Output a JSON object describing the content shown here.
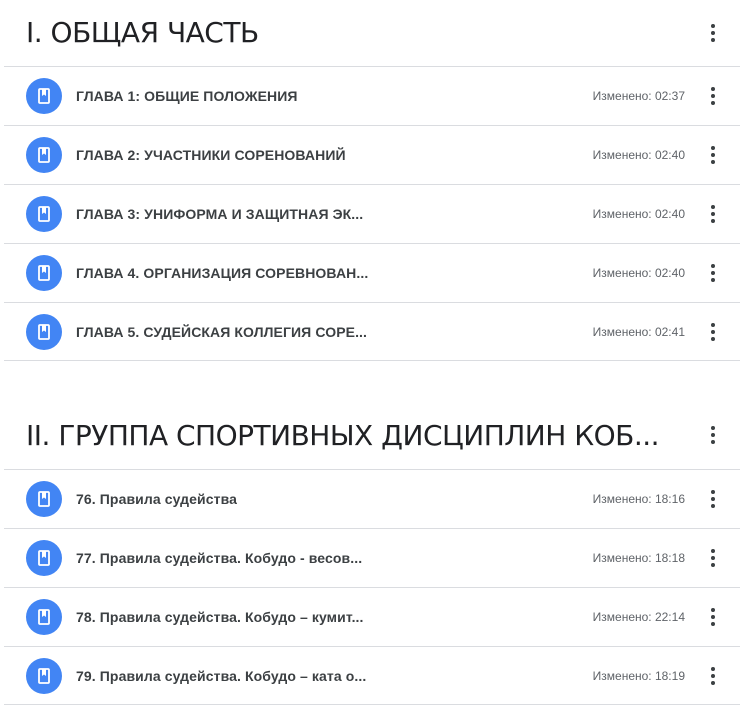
{
  "sections": [
    {
      "title": "I. ОБЩАЯ ЧАСТЬ",
      "items": [
        {
          "title": "ГЛАВА 1: ОБЩИЕ ПОЛОЖЕНИЯ",
          "modified": "Изменено: 02:37"
        },
        {
          "title": "ГЛАВА 2: УЧАСТНИКИ СОРЕНОВАНИЙ",
          "modified": "Изменено: 02:40"
        },
        {
          "title": "ГЛАВА 3: УНИФОРМА И ЗАЩИТНАЯ ЭК...",
          "modified": "Изменено: 02:40"
        },
        {
          "title": "ГЛАВА 4. ОРГАНИЗАЦИЯ СОРЕВНОВАН...",
          "modified": "Изменено: 02:40"
        },
        {
          "title": "ГЛАВА 5. СУДЕЙСКАЯ КОЛЛЕГИЯ СОРЕ...",
          "modified": "Изменено: 02:41"
        }
      ]
    },
    {
      "title": "II. ГРУППА СПОРТИВНЫХ ДИСЦИПЛИН КОБ...",
      "items": [
        {
          "title": "76. Правила судейства",
          "modified": "Изменено: 18:16"
        },
        {
          "title": "77. Правила судейства. Кобудо - весов...",
          "modified": "Изменено: 18:18"
        },
        {
          "title": "78. Правила судейства. Кобудо – кумит...",
          "modified": "Изменено: 22:14"
        },
        {
          "title": "79. Правила судейства. Кобудо – ката о...",
          "modified": "Изменено: 18:19"
        }
      ]
    }
  ],
  "icons": {
    "topic": "bookmark-icon",
    "menu": "more-vert-icon"
  },
  "colors": {
    "accent": "#4285f4",
    "divider": "#dadce0",
    "text": "#3c4043",
    "muted": "#5f6368"
  }
}
